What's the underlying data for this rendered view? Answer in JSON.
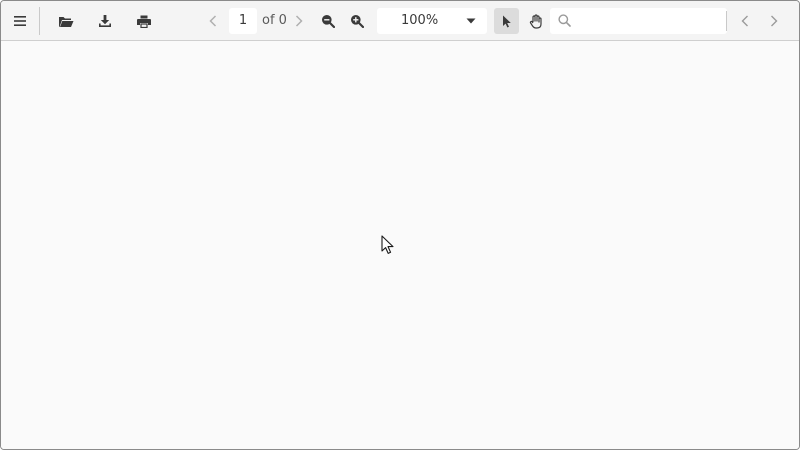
{
  "toolbar": {
    "page": {
      "current": "1",
      "count_label": "of 0"
    },
    "zoom": {
      "selected": "100%"
    },
    "search": {
      "value": "",
      "placeholder": ""
    }
  },
  "icons": {
    "menu": "hamburger-menu-icon",
    "open": "folder-open-icon",
    "download": "download-icon",
    "print": "print-icon",
    "prev_page": "chevron-left-icon",
    "next_page": "chevron-right-icon",
    "zoom_out": "zoom-out-icon",
    "zoom_in": "zoom-in-icon",
    "dropdown": "caret-down-icon",
    "select_tool": "pointer-arrow-icon",
    "hand_tool": "hand-icon",
    "search": "search-icon",
    "find_prev": "chevron-left-icon",
    "find_next": "chevron-right-icon",
    "mouse_cursor": "mouse-cursor-icon"
  },
  "colors": {
    "toolbar_bg": "#f4f4f4",
    "content_bg": "#fafafa",
    "icon": "#3a3a3a",
    "icon_disabled": "#b0b0b0",
    "active_tool_bg": "#dcdcdc"
  }
}
